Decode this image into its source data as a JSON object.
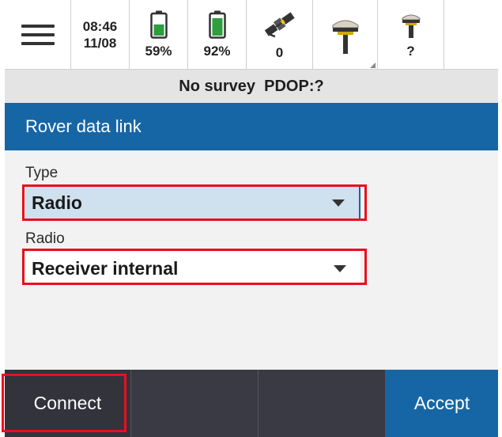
{
  "status_bar": {
    "menu_icon": "hamburger-icon",
    "time": "08:46",
    "date": "11/08",
    "battery_1": {
      "icon": "battery-icon",
      "label": "59%",
      "level": 59
    },
    "battery_2": {
      "icon": "battery-icon",
      "label": "92%",
      "level": 92
    },
    "satellites": {
      "icon": "satellite-icon",
      "label": "0"
    },
    "receiver": {
      "icon": "gnss-receiver-icon"
    },
    "rover": {
      "icon": "rover-antenna-icon",
      "label": "?"
    }
  },
  "info_strip": {
    "survey": "No survey",
    "pdop": "PDOP:?"
  },
  "title": "Rover data link",
  "form": {
    "type": {
      "label": "Type",
      "value": "Radio"
    },
    "radio": {
      "label": "Radio",
      "value": "Receiver internal"
    }
  },
  "buttons": {
    "connect": "Connect",
    "accept": "Accept"
  },
  "colors": {
    "accent": "#1666a6",
    "highlight": "#e8101d",
    "battery_green": "#2e9e3f",
    "bottom_bar": "#3a3a44"
  }
}
